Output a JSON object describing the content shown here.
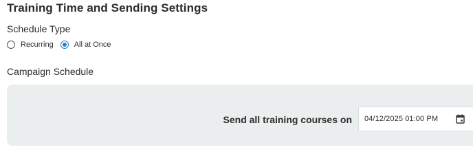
{
  "settings": {
    "title": "Training Time and Sending Settings",
    "schedule_type_label": "Schedule Type",
    "schedule_options": [
      {
        "label": "Recurring",
        "selected": false
      },
      {
        "label": "All at Once",
        "selected": true
      }
    ],
    "campaign_schedule_label": "Campaign Schedule",
    "send_label": "Send all training courses on",
    "send_datetime": "04/12/2025 01:00 PM",
    "calendar_icon": "calendar-icon"
  },
  "colors": {
    "accent": "#2d7fd3",
    "panel_bg": "#ebeeee",
    "text": "#2b2b2b"
  }
}
